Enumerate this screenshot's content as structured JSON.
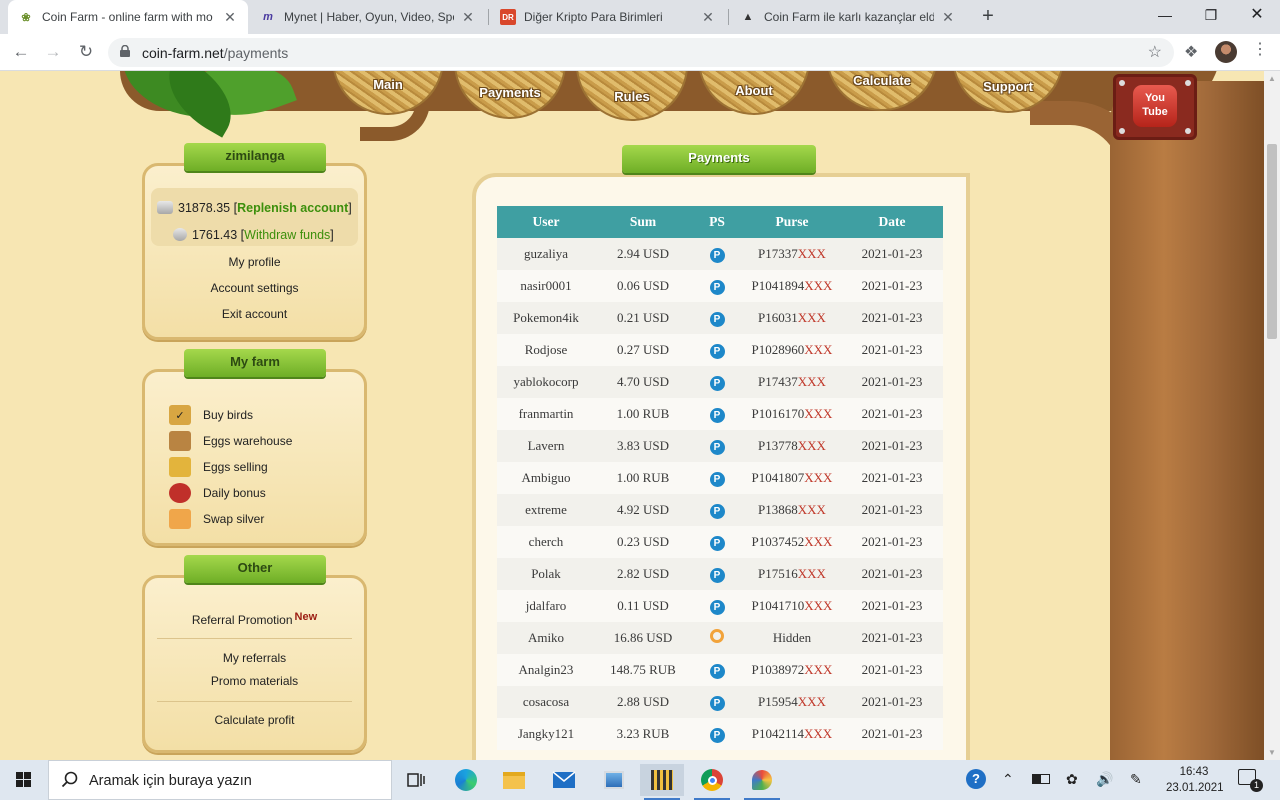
{
  "browser": {
    "tabs": [
      {
        "title": "Coin Farm - online farm with mo",
        "active": true
      },
      {
        "title": "Mynet | Haber, Oyun, Video, Spo",
        "active": false
      },
      {
        "title": "Diğer Kripto Para Birimleri",
        "active": false
      },
      {
        "title": "Coin Farm ile karlı kazançlar elde",
        "active": false
      }
    ],
    "url_host": "coin-farm.net",
    "url_path": "/payments"
  },
  "nav": {
    "items": [
      "Main",
      "Payments",
      "Rules",
      "About",
      "Calculate",
      "Support"
    ],
    "youtube_label": "You Tube"
  },
  "account": {
    "username": "zimilanga",
    "gold_balance": "31878.35",
    "replenish_label": "Replenish account",
    "silver_balance": "1761.43",
    "withdraw_label": "Withdraw funds",
    "links": [
      "My profile",
      "Account settings",
      "Exit account"
    ]
  },
  "farm": {
    "title": "My farm",
    "items": [
      "Buy birds",
      "Eggs warehouse",
      "Eggs selling",
      "Daily bonus",
      "Swap silver"
    ]
  },
  "other": {
    "title": "Other",
    "referral_promotion": "Referral Promotion",
    "new_badge": "New",
    "my_referrals": "My referrals",
    "promo_materials": "Promo materials",
    "calculate_profit": "Calculate profit"
  },
  "payments": {
    "title": "Payments",
    "columns": [
      "User",
      "Sum",
      "PS",
      "Purse",
      "Date"
    ],
    "rows": [
      {
        "user": "guzaliya",
        "sum": "2.94 USD",
        "ps": "payeer",
        "purse": "P17337",
        "mask": "XXX",
        "date": "2021-01-23"
      },
      {
        "user": "nasir0001",
        "sum": "0.06 USD",
        "ps": "payeer",
        "purse": "P1041894",
        "mask": "XXX",
        "date": "2021-01-23"
      },
      {
        "user": "Pokemon4ik",
        "sum": "0.21 USD",
        "ps": "payeer",
        "purse": "P16031",
        "mask": "XXX",
        "date": "2021-01-23"
      },
      {
        "user": "Rodjose",
        "sum": "0.27 USD",
        "ps": "payeer",
        "purse": "P1028960",
        "mask": "XXX",
        "date": "2021-01-23"
      },
      {
        "user": "yablokocorp",
        "sum": "4.70 USD",
        "ps": "payeer",
        "purse": "P17437",
        "mask": "XXX",
        "date": "2021-01-23"
      },
      {
        "user": "franmartin",
        "sum": "1.00 RUB",
        "ps": "payeer",
        "purse": "P1016170",
        "mask": "XXX",
        "date": "2021-01-23"
      },
      {
        "user": "Lavern",
        "sum": "3.83 USD",
        "ps": "payeer",
        "purse": "P13778",
        "mask": "XXX",
        "date": "2021-01-23"
      },
      {
        "user": "Ambiguo",
        "sum": "1.00 RUB",
        "ps": "payeer",
        "purse": "P1041807",
        "mask": "XXX",
        "date": "2021-01-23"
      },
      {
        "user": "extreme",
        "sum": "4.92 USD",
        "ps": "payeer",
        "purse": "P13868",
        "mask": "XXX",
        "date": "2021-01-23"
      },
      {
        "user": "cherch",
        "sum": "0.23 USD",
        "ps": "payeer",
        "purse": "P1037452",
        "mask": "XXX",
        "date": "2021-01-23"
      },
      {
        "user": "Polak",
        "sum": "2.82 USD",
        "ps": "payeer",
        "purse": "P17516",
        "mask": "XXX",
        "date": "2021-01-23"
      },
      {
        "user": "jdalfaro",
        "sum": "0.11 USD",
        "ps": "payeer",
        "purse": "P1041710",
        "mask": "XXX",
        "date": "2021-01-23"
      },
      {
        "user": "Amiko",
        "sum": "16.86 USD",
        "ps": "qiwi",
        "purse": "Hidden",
        "mask": "",
        "date": "2021-01-23"
      },
      {
        "user": "Analgin23",
        "sum": "148.75 RUB",
        "ps": "payeer",
        "purse": "P1038972",
        "mask": "XXX",
        "date": "2021-01-23"
      },
      {
        "user": "cosacosa",
        "sum": "2.88 USD",
        "ps": "payeer",
        "purse": "P15954",
        "mask": "XXX",
        "date": "2021-01-23"
      },
      {
        "user": "Jangky121",
        "sum": "3.23 RUB",
        "ps": "payeer",
        "purse": "P1042114",
        "mask": "XXX",
        "date": "2021-01-23"
      }
    ]
  },
  "taskbar": {
    "search_placeholder": "Aramak için buraya yazın",
    "time": "16:43",
    "date": "23.01.2021",
    "notification_count": "1"
  },
  "colors": {
    "table_header": "#3f9fa2",
    "ribbon_green": "#8cc43a",
    "page_bg": "#f7e6b3",
    "trunk_brown": "#9a6434",
    "mask_red": "#c0392b"
  }
}
